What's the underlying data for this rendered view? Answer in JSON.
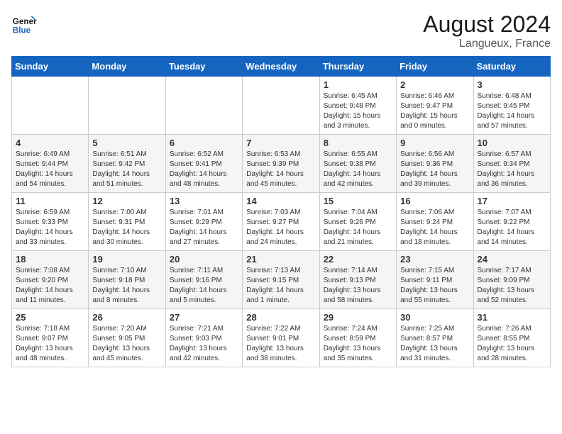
{
  "logo": {
    "line1": "General",
    "line2": "Blue"
  },
  "title": "August 2024",
  "subtitle": "Langueux, France",
  "days_of_week": [
    "Sunday",
    "Monday",
    "Tuesday",
    "Wednesday",
    "Thursday",
    "Friday",
    "Saturday"
  ],
  "weeks": [
    [
      {
        "day": "",
        "text": ""
      },
      {
        "day": "",
        "text": ""
      },
      {
        "day": "",
        "text": ""
      },
      {
        "day": "",
        "text": ""
      },
      {
        "day": "1",
        "text": "Sunrise: 6:45 AM\nSunset: 9:48 PM\nDaylight: 15 hours\nand 3 minutes."
      },
      {
        "day": "2",
        "text": "Sunrise: 6:46 AM\nSunset: 9:47 PM\nDaylight: 15 hours\nand 0 minutes."
      },
      {
        "day": "3",
        "text": "Sunrise: 6:48 AM\nSunset: 9:45 PM\nDaylight: 14 hours\nand 57 minutes."
      }
    ],
    [
      {
        "day": "4",
        "text": "Sunrise: 6:49 AM\nSunset: 9:44 PM\nDaylight: 14 hours\nand 54 minutes."
      },
      {
        "day": "5",
        "text": "Sunrise: 6:51 AM\nSunset: 9:42 PM\nDaylight: 14 hours\nand 51 minutes."
      },
      {
        "day": "6",
        "text": "Sunrise: 6:52 AM\nSunset: 9:41 PM\nDaylight: 14 hours\nand 48 minutes."
      },
      {
        "day": "7",
        "text": "Sunrise: 6:53 AM\nSunset: 9:39 PM\nDaylight: 14 hours\nand 45 minutes."
      },
      {
        "day": "8",
        "text": "Sunrise: 6:55 AM\nSunset: 9:38 PM\nDaylight: 14 hours\nand 42 minutes."
      },
      {
        "day": "9",
        "text": "Sunrise: 6:56 AM\nSunset: 9:36 PM\nDaylight: 14 hours\nand 39 minutes."
      },
      {
        "day": "10",
        "text": "Sunrise: 6:57 AM\nSunset: 9:34 PM\nDaylight: 14 hours\nand 36 minutes."
      }
    ],
    [
      {
        "day": "11",
        "text": "Sunrise: 6:59 AM\nSunset: 9:33 PM\nDaylight: 14 hours\nand 33 minutes."
      },
      {
        "day": "12",
        "text": "Sunrise: 7:00 AM\nSunset: 9:31 PM\nDaylight: 14 hours\nand 30 minutes."
      },
      {
        "day": "13",
        "text": "Sunrise: 7:01 AM\nSunset: 9:29 PM\nDaylight: 14 hours\nand 27 minutes."
      },
      {
        "day": "14",
        "text": "Sunrise: 7:03 AM\nSunset: 9:27 PM\nDaylight: 14 hours\nand 24 minutes."
      },
      {
        "day": "15",
        "text": "Sunrise: 7:04 AM\nSunset: 9:26 PM\nDaylight: 14 hours\nand 21 minutes."
      },
      {
        "day": "16",
        "text": "Sunrise: 7:06 AM\nSunset: 9:24 PM\nDaylight: 14 hours\nand 18 minutes."
      },
      {
        "day": "17",
        "text": "Sunrise: 7:07 AM\nSunset: 9:22 PM\nDaylight: 14 hours\nand 14 minutes."
      }
    ],
    [
      {
        "day": "18",
        "text": "Sunrise: 7:08 AM\nSunset: 9:20 PM\nDaylight: 14 hours\nand 11 minutes."
      },
      {
        "day": "19",
        "text": "Sunrise: 7:10 AM\nSunset: 9:18 PM\nDaylight: 14 hours\nand 8 minutes."
      },
      {
        "day": "20",
        "text": "Sunrise: 7:11 AM\nSunset: 9:16 PM\nDaylight: 14 hours\nand 5 minutes."
      },
      {
        "day": "21",
        "text": "Sunrise: 7:13 AM\nSunset: 9:15 PM\nDaylight: 14 hours\nand 1 minute."
      },
      {
        "day": "22",
        "text": "Sunrise: 7:14 AM\nSunset: 9:13 PM\nDaylight: 13 hours\nand 58 minutes."
      },
      {
        "day": "23",
        "text": "Sunrise: 7:15 AM\nSunset: 9:11 PM\nDaylight: 13 hours\nand 55 minutes."
      },
      {
        "day": "24",
        "text": "Sunrise: 7:17 AM\nSunset: 9:09 PM\nDaylight: 13 hours\nand 52 minutes."
      }
    ],
    [
      {
        "day": "25",
        "text": "Sunrise: 7:18 AM\nSunset: 9:07 PM\nDaylight: 13 hours\nand 48 minutes."
      },
      {
        "day": "26",
        "text": "Sunrise: 7:20 AM\nSunset: 9:05 PM\nDaylight: 13 hours\nand 45 minutes."
      },
      {
        "day": "27",
        "text": "Sunrise: 7:21 AM\nSunset: 9:03 PM\nDaylight: 13 hours\nand 42 minutes."
      },
      {
        "day": "28",
        "text": "Sunrise: 7:22 AM\nSunset: 9:01 PM\nDaylight: 13 hours\nand 38 minutes."
      },
      {
        "day": "29",
        "text": "Sunrise: 7:24 AM\nSunset: 8:59 PM\nDaylight: 13 hours\nand 35 minutes."
      },
      {
        "day": "30",
        "text": "Sunrise: 7:25 AM\nSunset: 8:57 PM\nDaylight: 13 hours\nand 31 minutes."
      },
      {
        "day": "31",
        "text": "Sunrise: 7:26 AM\nSunset: 8:55 PM\nDaylight: 13 hours\nand 28 minutes."
      }
    ]
  ]
}
